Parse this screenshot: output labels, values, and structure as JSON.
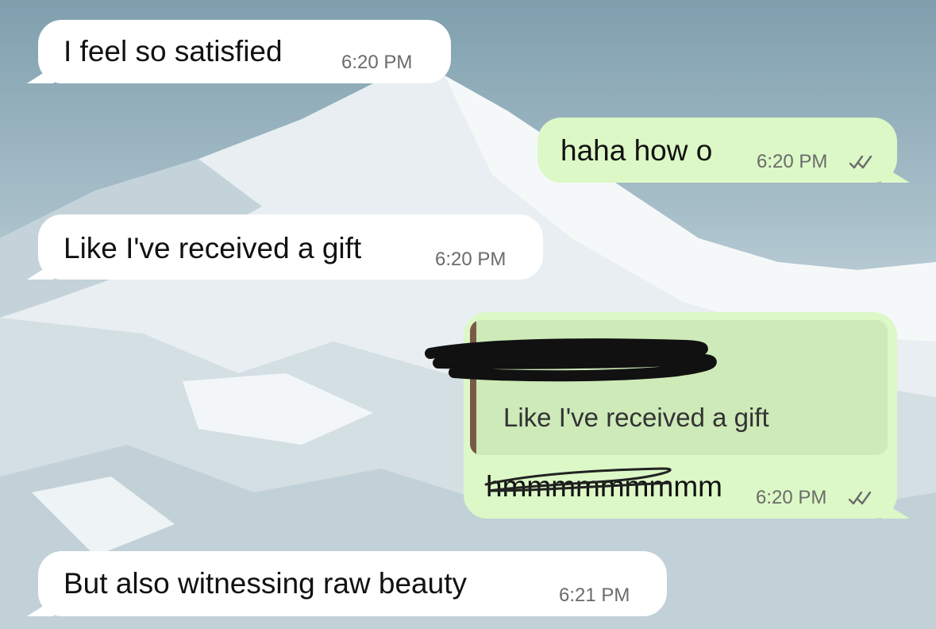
{
  "chat": {
    "messages": [
      {
        "direction": "incoming",
        "text": "I feel so satisfied",
        "time": "6:20 PM"
      },
      {
        "direction": "outgoing",
        "text": "haha how o",
        "time": "6:20 PM",
        "status_icon": "double-check-icon"
      },
      {
        "direction": "incoming",
        "text": "Like I've received a gift",
        "time": "6:20 PM"
      },
      {
        "direction": "outgoing",
        "quote": {
          "author_redacted": true,
          "text": "Like I've received a gift"
        },
        "text": "hmmmmmmmmm",
        "time": "6:20 PM",
        "status_icon": "double-check-icon"
      },
      {
        "direction": "incoming",
        "text": "But also witnessing raw beauty",
        "time": "6:21 PM"
      }
    ]
  },
  "colors": {
    "incoming_bubble": "#ffffff",
    "outgoing_bubble": "#dcf8c6",
    "quote_background": "#cdeab8",
    "quote_accent": "#7a5a45",
    "tick_color": "#6b6b6b"
  }
}
